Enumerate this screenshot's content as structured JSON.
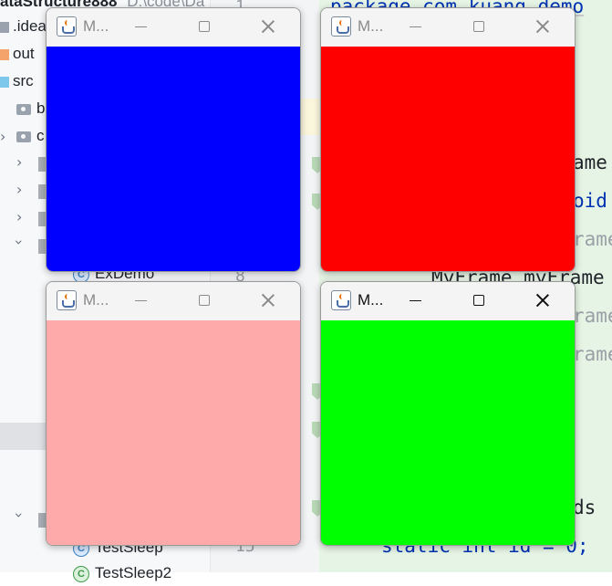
{
  "ide": {
    "project_root": "ataStructure888",
    "project_path": "D:\\code\\Da",
    "tree": [
      {
        "label": ".idea"
      },
      {
        "label": "out"
      },
      {
        "label": "src"
      },
      {
        "label": "b"
      },
      {
        "label": "c"
      },
      {
        "label": "ExDemo"
      },
      {
        "label": "TestSleep"
      },
      {
        "label": "TestSleep2"
      }
    ],
    "line_numbers": [
      "1",
      "8",
      "15"
    ],
    "code_lines": [
      "package com.kuang.demo",
      "ame",
      "oid",
      "rame",
      "MyFrame myFrame",
      "rame",
      "rame",
      "ds",
      "static int id = 0;"
    ]
  },
  "windows": [
    {
      "title": "M...",
      "color": "#0000ff",
      "active": false
    },
    {
      "title": "M...",
      "color": "#ff0000",
      "active": false
    },
    {
      "title": "M...",
      "color": "#ffaaaa",
      "active": false
    },
    {
      "title": "M...",
      "color": "#00ff00",
      "active": true
    }
  ]
}
